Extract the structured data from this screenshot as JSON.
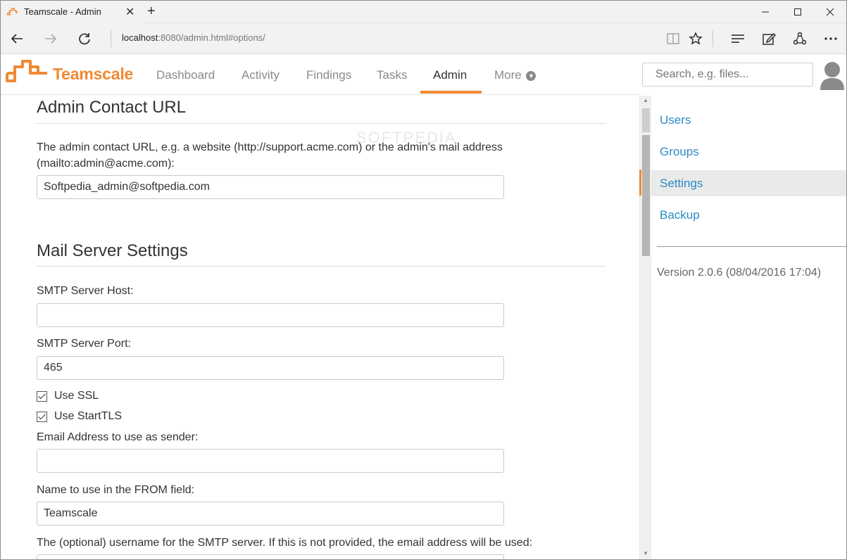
{
  "browser": {
    "tab_title": "Teamscale - Admin",
    "close_tab": "✕",
    "new_tab": "+",
    "url_host": "localhost",
    "url_rest": ":8080/admin.html#options/"
  },
  "app": {
    "brand": "Teamscale",
    "brand_color": "#f08a32",
    "nav": [
      {
        "label": "Dashboard",
        "active": false
      },
      {
        "label": "Activity",
        "active": false
      },
      {
        "label": "Findings",
        "active": false
      },
      {
        "label": "Tasks",
        "active": false
      },
      {
        "label": "Admin",
        "active": true
      },
      {
        "label": "More",
        "active": false
      }
    ],
    "search_placeholder": "Search, e.g. files..."
  },
  "main": {
    "watermark": "SOFTPEDIA",
    "admin_contact": {
      "heading": "Admin Contact URL",
      "description_line1": "The admin contact URL, e.g. a website (http://support.acme.com) or the admin's mail address",
      "description_line2": "(mailto:admin@acme.com):",
      "value": "Softpedia_admin@softpedia.com"
    },
    "mail_server": {
      "heading": "Mail Server Settings",
      "smtp_host_label": "SMTP Server Host:",
      "smtp_host_value": "",
      "smtp_port_label": "SMTP Server Port:",
      "smtp_port_value": "465",
      "use_ssl_label": "Use SSL",
      "use_ssl_checked": true,
      "use_starttls_label": "Use StartTLS",
      "use_starttls_checked": true,
      "sender_label": "Email Address to use as sender:",
      "sender_value": "",
      "from_label": "Name to use in the FROM field:",
      "from_value": "Teamscale",
      "username_label": "The (optional) username for the SMTP server. If this is not provided, the email address will be used:"
    }
  },
  "sidebar": {
    "links": [
      {
        "label": "Users",
        "active": false
      },
      {
        "label": "Groups",
        "active": false
      },
      {
        "label": "Settings",
        "active": true
      },
      {
        "label": "Backup",
        "active": false
      }
    ],
    "version": "Version 2.0.6 (08/04/2016 17:04)",
    "link_color": "#2c8ac7"
  }
}
